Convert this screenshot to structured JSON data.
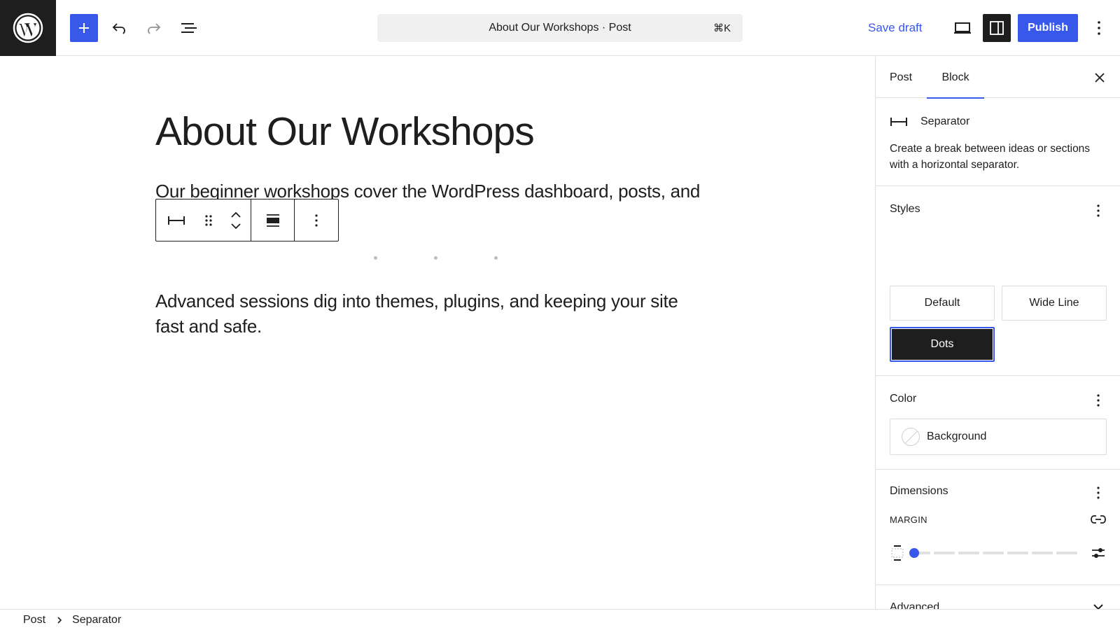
{
  "topbar": {
    "document_title": "About Our Workshops · Post",
    "shortcut": "⌘K",
    "save_draft": "Save draft",
    "publish": "Publish"
  },
  "editor": {
    "title": "About Our Workshops",
    "paragraph1": "Our beginner workshops cover the WordPress dashboard, posts, and",
    "paragraph2": "Advanced sessions dig into themes, plugins, and keeping your site fast and safe."
  },
  "sidebar": {
    "tabs": [
      {
        "label": "Post",
        "active": false
      },
      {
        "label": "Block",
        "active": true
      }
    ],
    "block_card": {
      "title": "Separator",
      "description": "Create a break between ideas or sections with a horizontal separator."
    },
    "styles": {
      "heading": "Styles",
      "options": [
        "Default",
        "Wide Line",
        "Dots"
      ],
      "selected": "Dots"
    },
    "color": {
      "heading": "Color",
      "background_label": "Background"
    },
    "dimensions": {
      "heading": "Dimensions",
      "margin_label": "MARGIN",
      "margin_value_fraction": 0
    },
    "advanced": {
      "heading": "Advanced"
    }
  },
  "breadcrumb": {
    "items": [
      "Post",
      "Separator"
    ]
  },
  "colors": {
    "accent": "#3858e9",
    "dark": "#1e1e1e",
    "border": "#e0e0e0"
  },
  "icons": [
    "wordpress-logo-icon",
    "plus-icon",
    "undo-icon",
    "redo-icon",
    "list-view-icon",
    "desktop-view-icon",
    "settings-panel-icon",
    "more-vertical-icon",
    "close-icon",
    "separator-icon",
    "drag-handle-icon",
    "chevron-up-icon",
    "chevron-down-icon",
    "align-icon",
    "link-icon",
    "sides-icon",
    "custom-settings-icon",
    "chevron-right-icon"
  ]
}
